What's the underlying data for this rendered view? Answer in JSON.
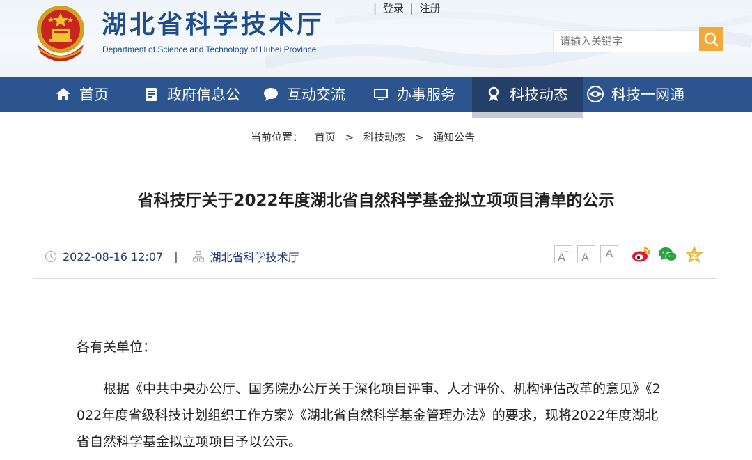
{
  "header": {
    "site_title": "湖北省科学技术厅",
    "site_subtitle": "Department of Science and Technology of Hubei Province",
    "login": "登录",
    "register": "注册",
    "separator": "|",
    "search_placeholder": "请输入关键字",
    "emblem_icon": "national-emblem-icon",
    "search_icon": "search-icon"
  },
  "nav": {
    "items": [
      {
        "label": "首页",
        "icon": "home-icon"
      },
      {
        "label": "政府信息公",
        "icon": "document-icon"
      },
      {
        "label": "互动交流",
        "icon": "chat-bubble-icon"
      },
      {
        "label": "办事服务",
        "icon": "monitor-icon"
      },
      {
        "label": "科技动态",
        "icon": "award-ribbon-icon"
      },
      {
        "label": "科技一网通",
        "icon": "eye-icon"
      }
    ],
    "active_index": 4
  },
  "breadcrumb": {
    "prefix": "当前位置：",
    "items": [
      "首页",
      "科技动态",
      "通知公告"
    ],
    "sep": ">"
  },
  "article": {
    "title": "省科技厅关于2022年度湖北省自然科学基金拟立项项目清单的公示",
    "date": "2022-08-16 12:07",
    "bar": "|",
    "source": "湖北省科学技术厅",
    "font_large": "A",
    "font_medium": "A",
    "font_small": "A",
    "share_icons": [
      "weibo-icon",
      "wechat-icon",
      "favorite-star-icon"
    ],
    "salutation": "各有关单位：",
    "paragraph_lines": [
      "根据《中共中央办公厅、国务院办公厅关于深化项目评审、人才评价、机构评估改革的意见》《2",
      "022年度省级科技计划组织工作方案》《湖北省自然科学基金管理办法》的要求，现将2022年度湖北",
      "省自然科学基金拟立项项目予以公示。"
    ]
  },
  "colors": {
    "nav_bg": "#2c5590",
    "nav_active_bg": "#243f6a",
    "title_blue": "#1f4e8f",
    "search_btn": "#f0a93b"
  }
}
